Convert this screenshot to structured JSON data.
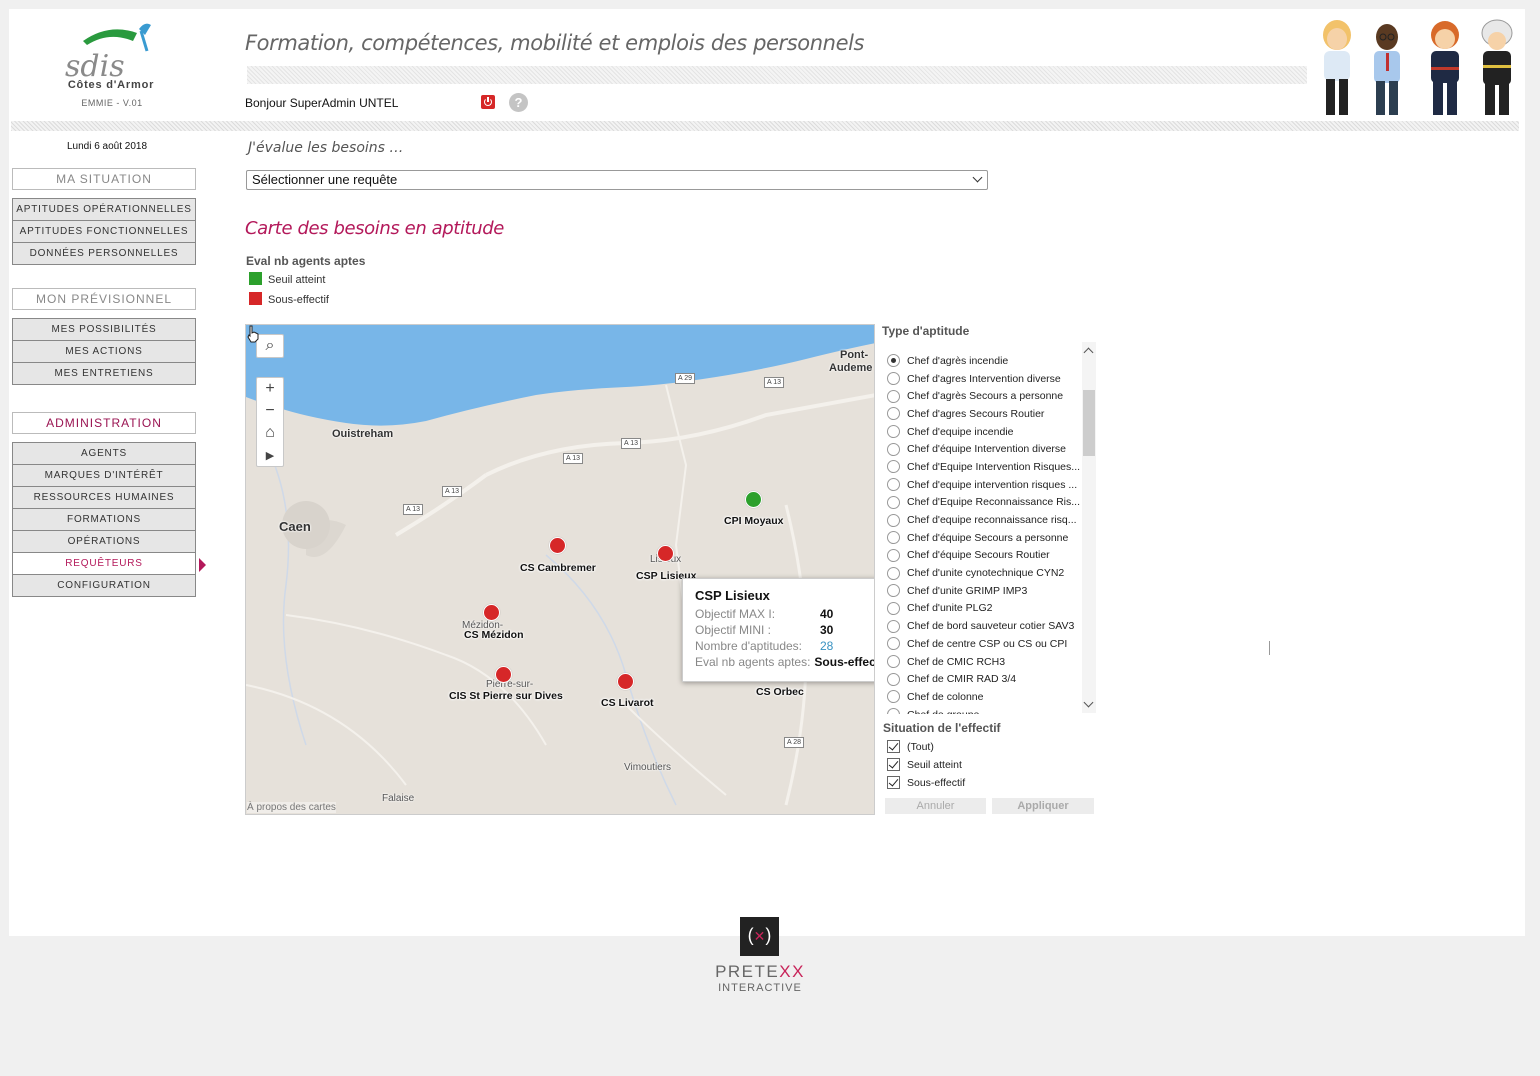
{
  "header": {
    "logo_org": "Côtes d'Armor",
    "logo_brand": "sdis",
    "version": "EMMIE - V.01",
    "site_title": "Formation, compétences, mobilité et emplois des personnels",
    "greeting": "Bonjour SuperAdmin UNTEL"
  },
  "sidebar": {
    "date": "Lundi 6 août 2018",
    "situation": {
      "title": "MA SITUATION",
      "items": [
        "APTITUDES OPÉRATIONNELLES",
        "APTITUDES FONCTIONNELLES",
        "DONNÉES PERSONNELLES"
      ]
    },
    "previsionnel": {
      "title": "MON PRÉVISIONNEL",
      "items": [
        "MES POSSIBILITÉS",
        "MES ACTIONS",
        "MES ENTRETIENS"
      ]
    },
    "administration": {
      "title": "ADMINISTRATION",
      "items": [
        "AGENTS",
        "MARQUES D'INTÉRÊT",
        "RESSOURCES HUMAINES",
        "FORMATIONS",
        "OPÉRATIONS",
        "REQUÊTEURS",
        "CONFIGURATION"
      ],
      "active": "REQUÊTEURS"
    }
  },
  "main": {
    "eval_heading": "J'évalue les besoins …",
    "select_value": "Sélectionner une requête",
    "map_title": "Carte des besoins en aptitude",
    "legend": {
      "title": "Eval nb agents aptes",
      "items": [
        {
          "label": "Seuil atteint",
          "color": "#2ca02c"
        },
        {
          "label": "Sous-effectif",
          "color": "#d62728"
        }
      ]
    }
  },
  "map": {
    "about": "À propos des cartes",
    "places": {
      "pont_audemer_1": "Pont-",
      "pont_audemer_2": "Audeme",
      "ouistreham": "Ouistreham",
      "caen": "Caen",
      "mezidon": "Mézidon-",
      "pierre_1": "Pierre-sur-",
      "vimoutiers": "Vimoutiers",
      "falaise": "Falaise",
      "lisieux": "Lisieux"
    },
    "roads": {
      "a29": "A 29",
      "a13_1": "A 13",
      "a13_2": "A 13",
      "a13_3": "A 13",
      "a13_4": "A 13",
      "a13_5": "A 13",
      "a28": "A 28"
    },
    "markers": [
      {
        "name": "CPI Moyaux",
        "status": "Seuil atteint"
      },
      {
        "name": "CS Cambremer",
        "status": "Sous-effectif"
      },
      {
        "name": "CSP Lisieux",
        "status": "Sous-effectif"
      },
      {
        "name": "CS Mézidon",
        "status": "Sous-effectif"
      },
      {
        "name": "CIS St Pierre sur Dives",
        "status": "Sous-effectif"
      },
      {
        "name": "CS Livarot",
        "status": "Sous-effectif"
      },
      {
        "name": "CS Orbec",
        "status": "Sous-effectif"
      }
    ],
    "tooltip": {
      "title": "CSP Lisieux",
      "max_label": "Objectif MAX I:",
      "max_value": "40",
      "mini_label": "Objectif MINI :",
      "mini_value": "30",
      "count_label": "Nombre d'aptitudes:",
      "count_value": "28",
      "eval_label": "Eval nb agents aptes:",
      "eval_value": "Sous-effectif"
    }
  },
  "filters": {
    "type_title": "Type d'aptitude",
    "type_items": [
      "Chef d'agrès incendie",
      "Chef d'agres Intervention diverse",
      "Chef d'agrès Secours a personne",
      "Chef d'agres Secours Routier",
      "Chef d'equipe incendie",
      "Chef d'équipe Intervention diverse",
      "Chef d'Equipe Intervention Risques...",
      "Chef d'equipe intervention risques ...",
      "Chef d'Equipe Reconnaissance Ris...",
      "Chef d'equipe reconnaissance risq...",
      "Chef d'équipe Secours a personne",
      "Chef d'équipe Secours Routier",
      "Chef d'unite cynotechnique CYN2",
      "Chef d'unite GRIMP IMP3",
      "Chef d'unite PLG2",
      "Chef de bord sauveteur cotier SAV3",
      "Chef de centre CSP ou CS ou CPI",
      "Chef de CMIC RCH3",
      "Chef de CMIR RAD 3/4",
      "Chef de colonne",
      "Chef de groupe"
    ],
    "type_selected": 0,
    "situation_title": "Situation de l'effectif",
    "situation_items": [
      "(Tout)",
      "Seuil atteint",
      "Sous-effectif"
    ],
    "cancel_label": "Annuler",
    "apply_label": "Appliquer"
  },
  "footer": {
    "brand_a": "PRETE",
    "brand_b": "XX",
    "sub": "INTERACTIVE"
  }
}
